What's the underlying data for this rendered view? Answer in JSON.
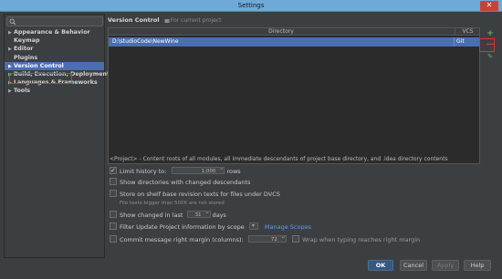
{
  "window": {
    "title": "Settings",
    "close_glyph": "✕"
  },
  "sidebar": {
    "search": {
      "placeholder": ""
    },
    "items": [
      {
        "label": "Appearance & Behavior",
        "arrow": "▶",
        "selected": false
      },
      {
        "label": "Keymap",
        "arrow": "",
        "selected": false
      },
      {
        "label": "Editor",
        "arrow": "▶",
        "selected": false
      },
      {
        "label": "Plugins",
        "arrow": "",
        "selected": false
      },
      {
        "label": "Version Control",
        "arrow": "▶",
        "selected": true
      },
      {
        "label": "Build, Execution, Deployment",
        "arrow": "▶",
        "selected": false
      },
      {
        "label": "Languages & Frameworks",
        "arrow": "▶",
        "selected": false
      },
      {
        "label": "Tools",
        "arrow": "▶",
        "selected": false
      }
    ]
  },
  "main": {
    "title": "Version Control",
    "subtitle": "For current project",
    "table": {
      "columns": [
        "Directory",
        "VCS"
      ],
      "rows": [
        {
          "directory": "D:\\studioCode\\NewWine",
          "vcs": "Git"
        }
      ]
    },
    "side_buttons": {
      "add": "+",
      "remove": "—",
      "edit": "✎"
    },
    "description": "<Project> - Content roots of all modules, all immediate descendants of project base directory, and .idea directory contents",
    "options": {
      "limit_history": {
        "label": "Limit history to:",
        "checked": true,
        "value": "1,000",
        "unit": "rows"
      },
      "show_dirs": {
        "label": "Show directories with changed descendants",
        "checked": false
      },
      "store_shelf": {
        "label": "Store on shelf base revision texts for files under DVCS",
        "checked": false,
        "hint": "File texts bigger than 500K are not stored"
      },
      "show_changed": {
        "label": "Show changed in last",
        "checked": false,
        "value": "31",
        "unit": "days"
      },
      "filter_update": {
        "label": "Filter Update Project information by scope",
        "checked": false,
        "link": "Manage Scopes"
      },
      "commit_margin": {
        "label": "Commit message right margin (columns):",
        "checked": false,
        "value": "72",
        "wrap_label": "Wrap when typing reaches right margin"
      }
    }
  },
  "footer": {
    "ok": "OK",
    "cancel": "Cancel",
    "apply": "Apply",
    "help": "Help"
  },
  "colors": {
    "accent": "#4b6eaf",
    "highlight_box": "#e53030",
    "link": "#589df6"
  }
}
